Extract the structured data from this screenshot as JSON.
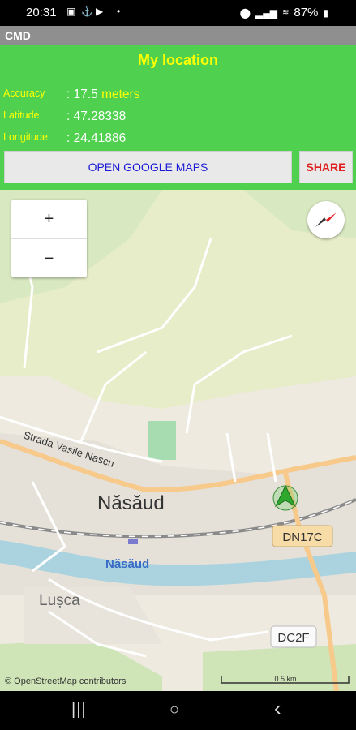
{
  "status_bar": {
    "time": "20:31",
    "battery": "87%",
    "left_icons": [
      "gallery-icon",
      "anchor-icon",
      "youtube-icon",
      "dot-icon"
    ],
    "right_icons": [
      "location-icon",
      "signal-icon",
      "wifi-icon",
      "signal-icon",
      "battery-icon"
    ]
  },
  "app": {
    "title": "CMD"
  },
  "location": {
    "title": "My location",
    "accuracy_label": "Accuracy",
    "accuracy_value": ": 17.5",
    "accuracy_unit": "meters",
    "latitude_label": "Latitude",
    "latitude_value": ": 47.28338",
    "longitude_label": "Longitude",
    "longitude_value": ": 24.41886"
  },
  "buttons": {
    "maps": "OPEN GOOGLE MAPS",
    "share": "SHARE"
  },
  "map": {
    "zoom_in": "+",
    "zoom_out": "−",
    "labels": {
      "street": "Strada Vasile Nascu",
      "town": "Năsăud",
      "station": "Năsăud",
      "village": "Lușca",
      "road1": "DN17C",
      "road2": "DC2F"
    },
    "attribution": "© OpenStreetMap contributors",
    "scale": "0.5 km",
    "colors": {
      "water": "#aad3df",
      "main_road": "#f7c98b",
      "forest": "#c8e3b4",
      "grass": "#e6edc8"
    }
  },
  "nav": {
    "recents": "|||",
    "home": "○",
    "back": "‹"
  }
}
